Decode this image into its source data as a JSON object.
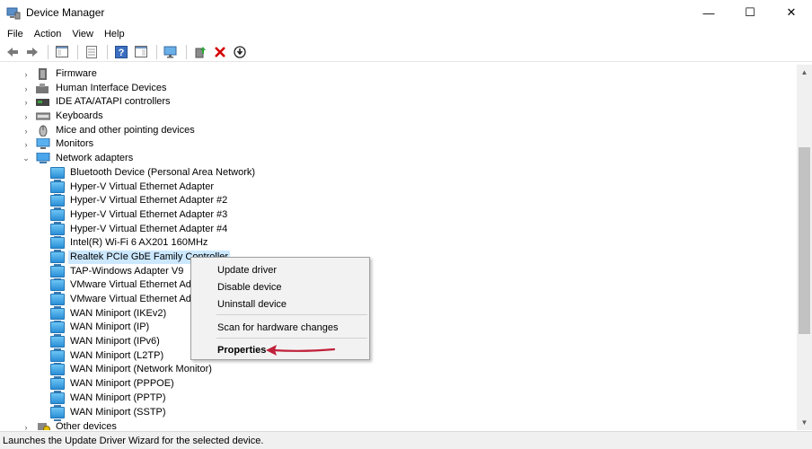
{
  "window": {
    "title": "Device Manager",
    "minimize": "—",
    "maximize": "☐",
    "close": "✕"
  },
  "menu": [
    "File",
    "Action",
    "View",
    "Help"
  ],
  "tree": {
    "categories_top": [
      {
        "label": "Firmware",
        "icon": "firmware-icon"
      },
      {
        "label": "Human Interface Devices",
        "icon": "hid-icon"
      },
      {
        "label": "IDE ATA/ATAPI controllers",
        "icon": "ide-icon"
      },
      {
        "label": "Keyboards",
        "icon": "keyboard-icon"
      },
      {
        "label": "Mice and other pointing devices",
        "icon": "mouse-icon"
      },
      {
        "label": "Monitors",
        "icon": "monitor-icon"
      }
    ],
    "network_adapters": {
      "label": "Network adapters",
      "expanded": true,
      "children": [
        "Bluetooth Device (Personal Area Network)",
        "Hyper-V Virtual Ethernet Adapter",
        "Hyper-V Virtual Ethernet Adapter #2",
        "Hyper-V Virtual Ethernet Adapter #3",
        "Hyper-V Virtual Ethernet Adapter #4",
        "Intel(R) Wi-Fi 6 AX201 160MHz",
        "Realtek PCIe GbE Family Controller",
        "TAP-Windows Adapter V9",
        "VMware Virtual Ethernet Adapt",
        "VMware Virtual Ethernet Adapt",
        "WAN Miniport (IKEv2)",
        "WAN Miniport (IP)",
        "WAN Miniport (IPv6)",
        "WAN Miniport (L2TP)",
        "WAN Miniport (Network Monitor)",
        "WAN Miniport (PPPOE)",
        "WAN Miniport (PPTP)",
        "WAN Miniport (SSTP)"
      ],
      "selected_index": 6
    },
    "categories_bottom": [
      {
        "label": "Other devices",
        "icon": "other-devices-icon"
      }
    ]
  },
  "context_menu": {
    "update_driver": "Update driver",
    "disable_device": "Disable device",
    "uninstall_device": "Uninstall device",
    "scan_changes": "Scan for hardware changes",
    "properties": "Properties"
  },
  "status": "Launches the Update Driver Wizard for the selected device.",
  "colors": {
    "selection": "#cce8ff",
    "annotation_arrow": "#c0203a",
    "delete_red": "#d40000"
  }
}
